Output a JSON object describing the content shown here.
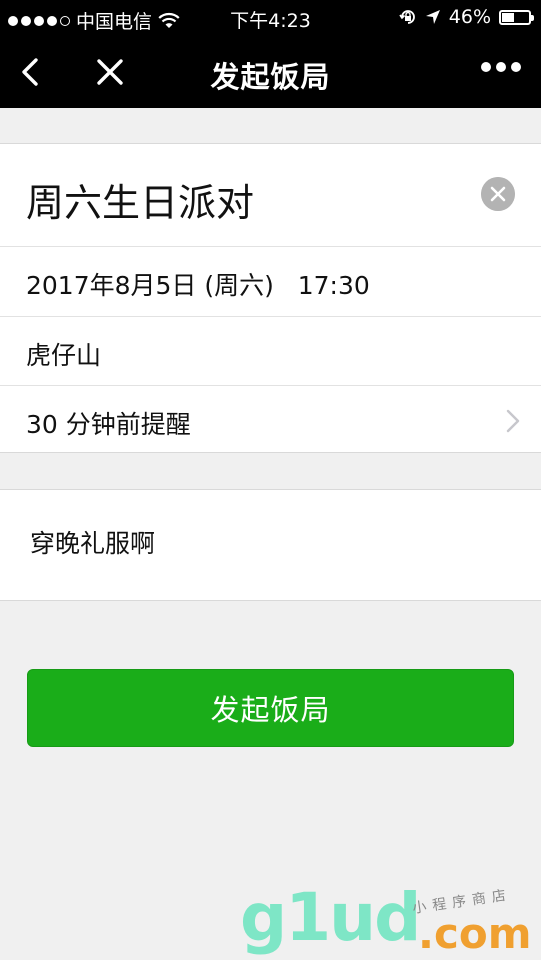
{
  "status_bar": {
    "carrier": "中国电信",
    "time": "下午4:23",
    "battery_percent": "46%",
    "battery_level": 0.46
  },
  "nav": {
    "title": "发起饭局"
  },
  "form": {
    "title_value": "周六生日派对",
    "datetime": "2017年8月5日 (周六)   17:30",
    "location": "虎仔山",
    "reminder": "30 分钟前提醒",
    "note": "穿晚礼服啊"
  },
  "submit_label": "发起饭局",
  "watermark": {
    "big": "g1ud",
    "com": ".com",
    "small": "小程序商店"
  },
  "colors": {
    "primary": "#1aad19",
    "navbar": "#000000",
    "background": "#f0f0f0"
  }
}
